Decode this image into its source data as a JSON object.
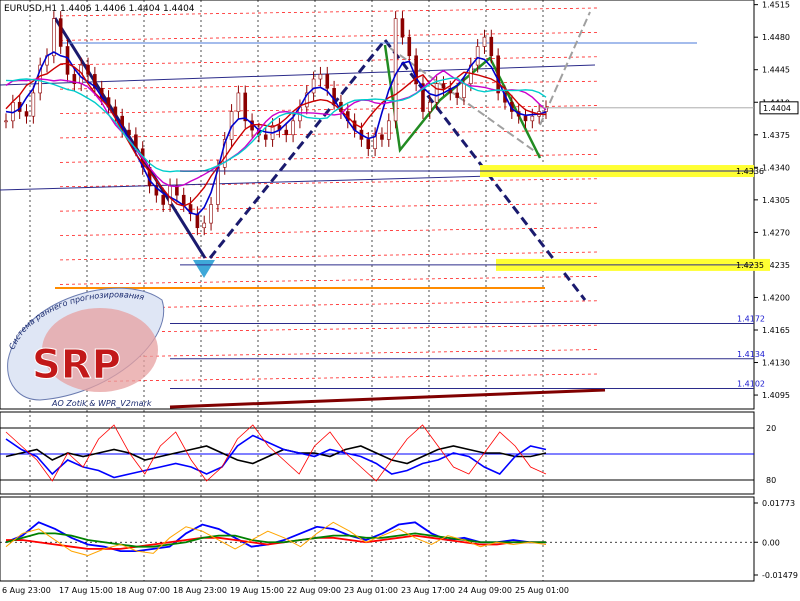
{
  "header": {
    "text": "EURUSD,H1  1.4406 1.4406 1.4404 1.4404"
  },
  "chart_data": {
    "type": "line",
    "symbol": "EURUSD",
    "timeframe": "H1",
    "ohlc": {
      "open": 1.4406,
      "high": 1.4406,
      "low": 1.4404,
      "close": 1.4404
    },
    "ylim": [
      1.408,
      1.452
    ],
    "y_ticks": [
      "1.4515",
      "1.4480",
      "1.4445",
      "1.4410",
      "1.4375",
      "1.4340",
      "1.4305",
      "1.4270",
      "1.4235",
      "1.4200",
      "1.4165",
      "1.4130",
      "1.4095"
    ],
    "x_ticks": [
      "6 Aug 23:00",
      "17 Aug 15:00",
      "18 Aug 07:00",
      "18 Aug 23:00",
      "19 Aug 15:00",
      "22 Aug 09:00",
      "23 Aug 01:00",
      "23 Aug 17:00",
      "24 Aug 09:00",
      "25 Aug 01:00"
    ],
    "current_price": "1.4404",
    "price_labels": [
      {
        "label": "1.4336",
        "value": 1.4336,
        "highlight": true
      },
      {
        "label": "1.4235",
        "value": 1.4235,
        "highlight": true
      },
      {
        "label": "1.4172",
        "value": 1.4172,
        "highlight": false
      },
      {
        "label": "1.4134",
        "value": 1.4134,
        "highlight": false
      },
      {
        "label": "1.4102",
        "value": 1.4102,
        "highlight": false
      }
    ],
    "close_series": [
      1.439,
      1.441,
      1.44,
      1.4395,
      1.442,
      1.445,
      1.446,
      1.45,
      1.447,
      1.444,
      1.443,
      1.445,
      1.444,
      1.4425,
      1.4415,
      1.4405,
      1.4395,
      1.438,
      1.4375,
      1.436,
      1.434,
      1.432,
      1.431,
      1.43,
      1.432,
      1.431,
      1.43,
      1.429,
      1.4275,
      1.428,
      1.43,
      1.434,
      1.437,
      1.44,
      1.442,
      1.439,
      1.438,
      1.4375,
      1.437,
      1.4385,
      1.438,
      1.4375,
      1.439,
      1.4405,
      1.442,
      1.4435,
      1.444,
      1.4425,
      1.441,
      1.44,
      1.439,
      1.438,
      1.437,
      1.436,
      1.4375,
      1.437,
      1.439,
      1.45,
      1.448,
      1.446,
      1.443,
      1.44,
      1.441,
      1.443,
      1.4425,
      1.442,
      1.4415,
      1.443,
      1.445,
      1.447,
      1.448,
      1.446,
      1.442,
      1.441,
      1.44,
      1.4395,
      1.439,
      1.4395,
      1.44,
      1.4404
    ],
    "indicator1": {
      "levels": [
        "20",
        "80"
      ],
      "series": [
        {
          "name": "",
          "color": "#000000",
          "values": [
            0.45,
            0.5,
            0.55,
            0.4,
            0.5,
            0.45,
            0.5,
            0.55,
            0.5,
            0.4,
            0.45,
            0.5,
            0.55,
            0.6,
            0.5,
            0.4,
            0.35,
            0.45,
            0.55,
            0.5,
            0.5,
            0.45,
            0.55,
            0.6,
            0.5,
            0.4,
            0.35,
            0.45,
            0.55,
            0.6,
            0.55,
            0.5,
            0.5,
            0.45,
            0.45,
            0.5
          ]
        },
        {
          "name": "",
          "color": "#0000ff",
          "values": [
            0.7,
            0.55,
            0.45,
            0.2,
            0.4,
            0.3,
            0.25,
            0.15,
            0.2,
            0.25,
            0.3,
            0.35,
            0.3,
            0.2,
            0.3,
            0.6,
            0.75,
            0.65,
            0.55,
            0.5,
            0.45,
            0.55,
            0.5,
            0.45,
            0.35,
            0.2,
            0.25,
            0.35,
            0.4,
            0.5,
            0.45,
            0.3,
            0.2,
            0.45,
            0.6,
            0.55
          ]
        },
        {
          "name": "",
          "color": "#ff0000",
          "values": [
            0.8,
            0.6,
            0.4,
            0.1,
            0.5,
            0.3,
            0.7,
            0.9,
            0.5,
            0.2,
            0.6,
            0.8,
            0.4,
            0.1,
            0.3,
            0.7,
            0.9,
            0.6,
            0.4,
            0.2,
            0.6,
            0.8,
            0.5,
            0.3,
            0.1,
            0.4,
            0.7,
            0.9,
            0.6,
            0.3,
            0.2,
            0.5,
            0.8,
            0.6,
            0.3,
            0.2
          ]
        }
      ]
    },
    "indicator2": {
      "y_ticks": [
        "0.01773",
        "0.00",
        "-0.01479"
      ],
      "ylim": [
        -0.01479,
        0.01773
      ],
      "series": [
        {
          "name": "",
          "color": "#0000ff",
          "values": [
            0,
            0.003,
            0.009,
            0.006,
            0.002,
            -0.001,
            -0.002,
            -0.004,
            -0.004,
            -0.003,
            -0.002,
            0.004,
            0.008,
            0.006,
            0.002,
            -0.002,
            -0.001,
            0.001,
            0.004,
            0.007,
            0.006,
            0.003,
            0.001,
            0.004,
            0.008,
            0.009,
            0.004,
            0.001,
            0.002,
            0.0,
            0.0,
            0.001,
            0.0,
            0.0
          ]
        },
        {
          "name": "",
          "color": "#ff0000",
          "values": [
            0.001,
            0.001,
            0.0,
            -0.001,
            -0.002,
            -0.003,
            -0.003,
            -0.003,
            -0.002,
            -0.001,
            0.0,
            0.001,
            0.002,
            0.002,
            0.001,
            0.0,
            -0.001,
            0.0,
            0.001,
            0.002,
            0.002,
            0.001,
            0.0,
            0.001,
            0.002,
            0.003,
            0.002,
            0.001,
            0.0,
            -0.001,
            -0.001,
            0.0,
            0.0,
            0.0
          ]
        },
        {
          "name": "",
          "color": "#008000",
          "values": [
            0.0,
            0.002,
            0.004,
            0.004,
            0.003,
            0.001,
            0.0,
            -0.001,
            -0.002,
            -0.002,
            -0.001,
            0.0,
            0.002,
            0.003,
            0.003,
            0.001,
            0.0,
            0.0,
            0.001,
            0.002,
            0.003,
            0.003,
            0.002,
            0.002,
            0.003,
            0.004,
            0.003,
            0.002,
            0.001,
            0.0,
            0.0,
            0.0,
            0.0,
            0.0
          ]
        },
        {
          "name": "",
          "color": "#ffa500",
          "values": [
            -0.002,
            0.004,
            0.006,
            0.001,
            -0.004,
            -0.006,
            -0.003,
            -0.001,
            -0.004,
            -0.005,
            0.002,
            0.007,
            0.005,
            0.001,
            -0.003,
            0.001,
            0.005,
            0.002,
            -0.002,
            0.004,
            0.009,
            0.005,
            0.0,
            0.003,
            0.006,
            0.002,
            -0.001,
            0.003,
            0.001,
            -0.002,
            0.0,
            -0.001,
            0.0,
            -0.001
          ]
        }
      ]
    }
  },
  "logo": {
    "text": "SRP",
    "arc_top": "Система раннего прогнозирования",
    "arc_bottom": "AO Zotik & WPR_V2mark"
  },
  "colors": {
    "grid": "#000000",
    "dash_red": "#ff0000",
    "navy": "#1a1a6e",
    "highlight": "#ffff33",
    "gray_dash": "#a0a0a0",
    "green_zig": "#228b22"
  }
}
